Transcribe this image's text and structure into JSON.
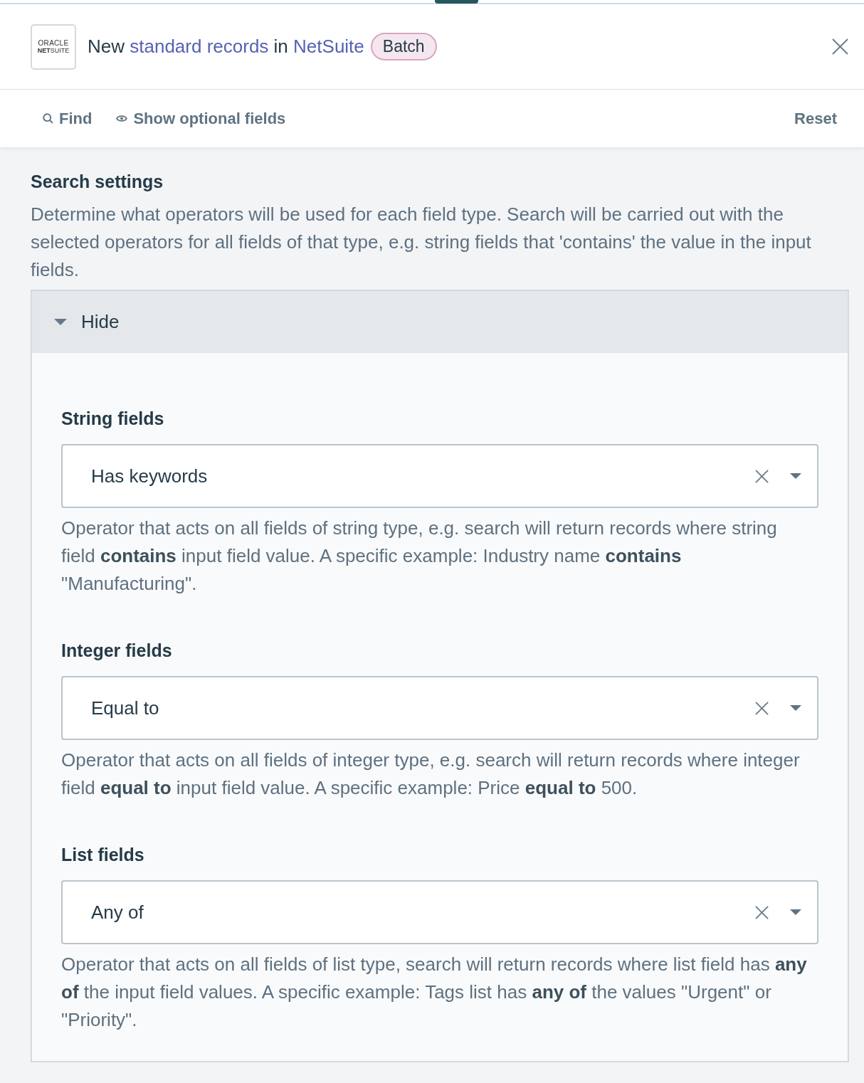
{
  "header": {
    "logo": {
      "line_1": "ORACLE",
      "line_2": "**NET**SUITE"
    },
    "title_parts": [
      {
        "text": "New",
        "kind": "text"
      },
      {
        "text": "standard records",
        "kind": "link"
      },
      {
        "text": "in",
        "kind": "text"
      },
      {
        "text": "NetSuite",
        "kind": "link"
      }
    ],
    "badge": "Batch"
  },
  "toolbar": {
    "find": "Find",
    "optional_fields": "Show optional fields",
    "reset": "Reset"
  },
  "section": {
    "title": "Search settings",
    "description": "Determine what operators will be used for each field type. Search will be carried out with the selected operators for all fields of that type, e.g. string fields that 'contains' the value in the input fields."
  },
  "panel": {
    "toggle_label": "Hide",
    "expanded": true,
    "fields": [
      {
        "label": "String fields",
        "value": "Has keywords",
        "description": "Operator that acts on all fields of string type, e.g. search will return records where string field **contains** input field value. A specific example: Industry name **contains** \"Manufacturing\"."
      },
      {
        "label": "Integer fields",
        "value": "Equal to",
        "description": "Operator that acts on all fields of integer type, e.g. search will return records where integer field **equal to** input field value. A specific example: Price **equal to** 500."
      },
      {
        "label": "List fields",
        "value": "Any of",
        "description": "Operator that acts on all fields of list type, search will return records where list field has **any of** the input field values. A specific example: Tags list has **any of** the values \"Urgent\" or \"Priority\"."
      }
    ]
  }
}
